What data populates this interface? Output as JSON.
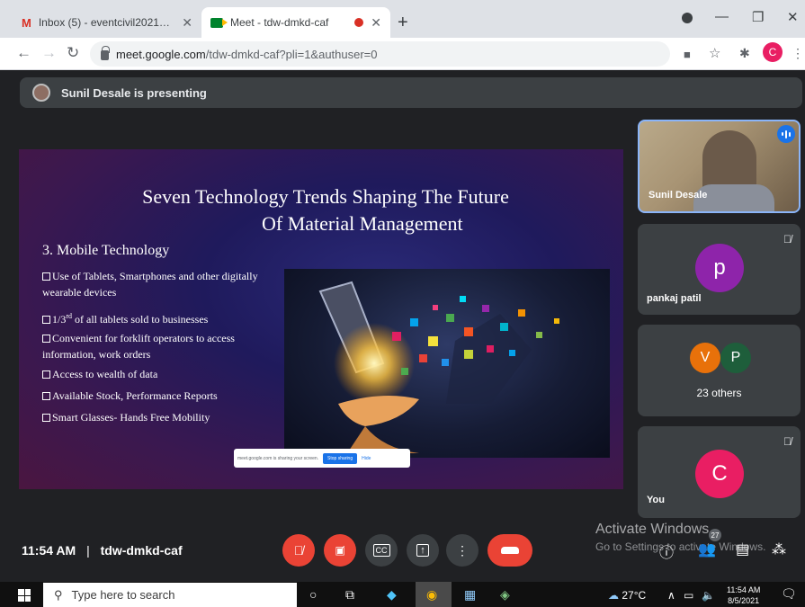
{
  "browser": {
    "tabs": [
      {
        "title": "Inbox (5) - eventcivil2021@gmail",
        "icon": "gmail-icon"
      },
      {
        "title": "Meet - tdw-dmkd-caf",
        "icon": "meet-icon"
      }
    ],
    "url_host": "meet.google.com",
    "url_path": "/tdw-dmkd-caf?pli=1&authuser=0",
    "profile_initial": "C"
  },
  "meet": {
    "presenting_text": "Sunil Desale is presenting",
    "time": "11:54 AM",
    "separator": "|",
    "meeting_code": "tdw-dmkd-caf",
    "people_count": "27"
  },
  "slide": {
    "title_line1": "Seven Technology Trends Shaping The Future",
    "title_line2": "Of Material Management",
    "subtitle": "3.  Mobile Technology",
    "bullets": [
      "Use of Tablets, Smartphones and other digitally wearable devices",
      "1/3",
      "Convenient for forklift operators to access information, work orders",
      "Access to wealth of data",
      "Available Stock, Performance Reports",
      "Smart Glasses- Hands Free Mobility"
    ],
    "bullet2_sup": "rd",
    "bullet2_rest": " of all tablets sold to businesses",
    "share_banner_text": "meet.google.com is sharing your screen.",
    "share_banner_stop": "Stop sharing",
    "share_banner_hide": "Hide"
  },
  "participants": {
    "presenter": {
      "name": "Sunil Desale"
    },
    "tile2": {
      "name": "pankaj patil",
      "initial": "p",
      "color": "#8e24aa"
    },
    "tile3": {
      "label": "23 others",
      "initials": [
        "V",
        "P"
      ],
      "colors": [
        "#e8710a",
        "#1e5e3b"
      ]
    },
    "tile4": {
      "name": "You",
      "initial": "C",
      "color": "#e91e63"
    }
  },
  "watermark": {
    "line1": "Activate Windows",
    "line2": "Go to Settings to activate Windows."
  },
  "taskbar": {
    "search_placeholder": "Type here to search",
    "temperature": "27°C",
    "clock_time": "11:54 AM",
    "clock_date": "8/5/2021"
  }
}
